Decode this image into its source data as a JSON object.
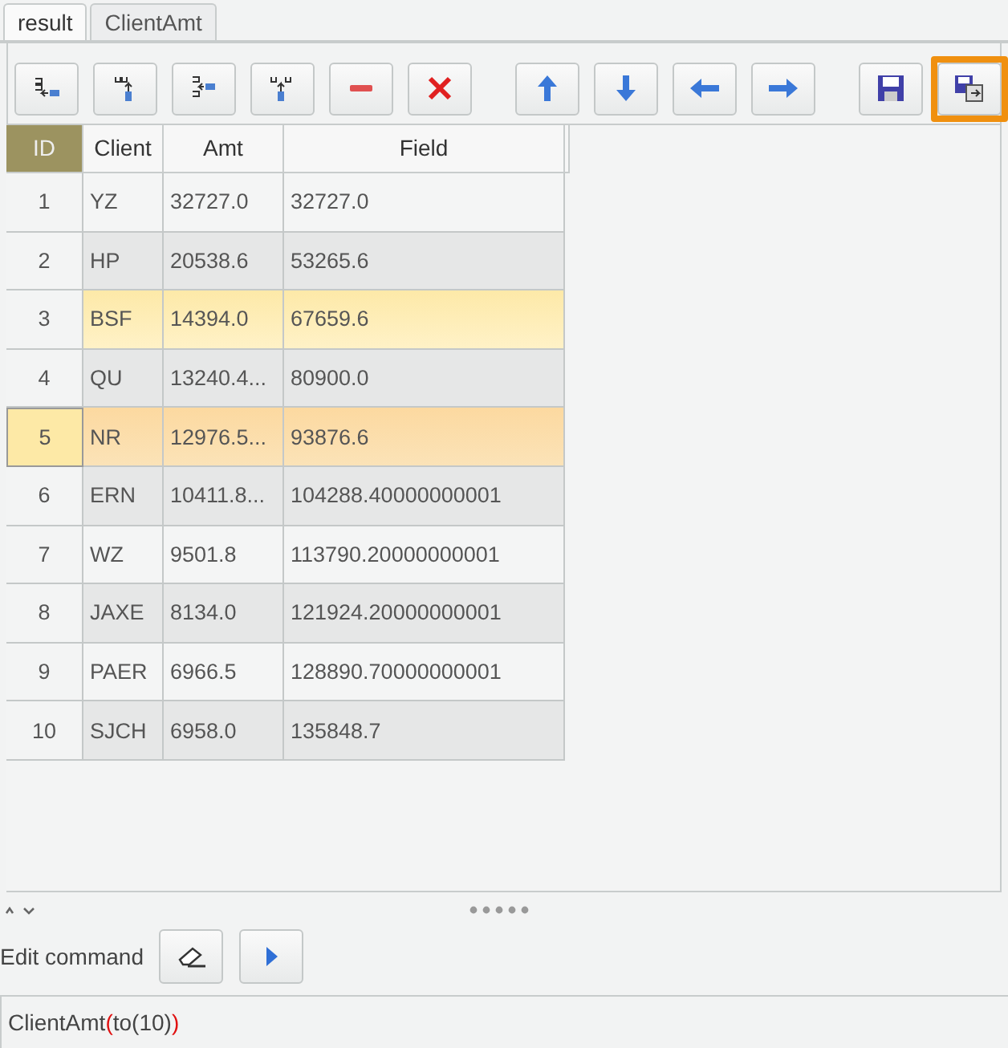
{
  "tabs": [
    {
      "label": "result",
      "selected": true
    },
    {
      "label": "ClientAmt",
      "selected": false
    }
  ],
  "toolbar": [
    {
      "kind": "insert-col",
      "focused": false
    },
    {
      "kind": "insert-row",
      "focused": false
    },
    {
      "kind": "add-col",
      "focused": false
    },
    {
      "kind": "add-row",
      "focused": false
    },
    {
      "kind": "delete",
      "focused": false
    },
    {
      "kind": "clear",
      "focused": false
    },
    {
      "kind": "up",
      "focused": false
    },
    {
      "kind": "down",
      "focused": false
    },
    {
      "kind": "left",
      "focused": false
    },
    {
      "kind": "right",
      "focused": false
    },
    {
      "kind": "save",
      "focused": false
    },
    {
      "kind": "save-as",
      "focused": true
    }
  ],
  "table": {
    "columns": [
      "ID",
      "Client",
      "Amt",
      "Field"
    ],
    "rows": [
      {
        "cells": [
          "1",
          "YZ",
          "32727.0",
          "32727.0"
        ],
        "selected": false,
        "highlighted": false
      },
      {
        "cells": [
          "2",
          "HP",
          "20538.6",
          "53265.6"
        ],
        "selected": false,
        "highlighted": false
      },
      {
        "cells": [
          "3",
          "BSF",
          "14394.0",
          "67659.6"
        ],
        "selected": false,
        "highlighted": true
      },
      {
        "cells": [
          "4",
          "QU",
          "13240.4...",
          "80900.0"
        ],
        "selected": false,
        "highlighted": false
      },
      {
        "cells": [
          "5",
          "NR",
          "12976.5...",
          "93876.6"
        ],
        "selected": true,
        "highlighted": false
      },
      {
        "cells": [
          "6",
          "ERN",
          "10411.8...",
          "104288.40000000001"
        ],
        "selected": false,
        "highlighted": false
      },
      {
        "cells": [
          "7",
          "WZ",
          "9501.8",
          "113790.20000000001"
        ],
        "selected": false,
        "highlighted": false
      },
      {
        "cells": [
          "8",
          "JAXE",
          "8134.0",
          "121924.20000000001"
        ],
        "selected": false,
        "highlighted": false
      },
      {
        "cells": [
          "9",
          "PAER",
          "6966.5",
          "128890.70000000001"
        ],
        "selected": false,
        "highlighted": false
      },
      {
        "cells": [
          "10",
          "SJCH",
          "6958.0",
          "135848.7"
        ],
        "selected": false,
        "highlighted": false
      }
    ]
  },
  "command": {
    "label": "Edit command",
    "buttons": [
      {
        "kind": "eraser"
      },
      {
        "kind": "run"
      }
    ],
    "parts": [
      {
        "text": "ClientAmt",
        "color": "#444444"
      },
      {
        "text": "(",
        "color": "#e01010"
      },
      {
        "text": "to(10)",
        "color": "#444444"
      },
      {
        "text": ")",
        "color": "#e01010"
      }
    ]
  }
}
